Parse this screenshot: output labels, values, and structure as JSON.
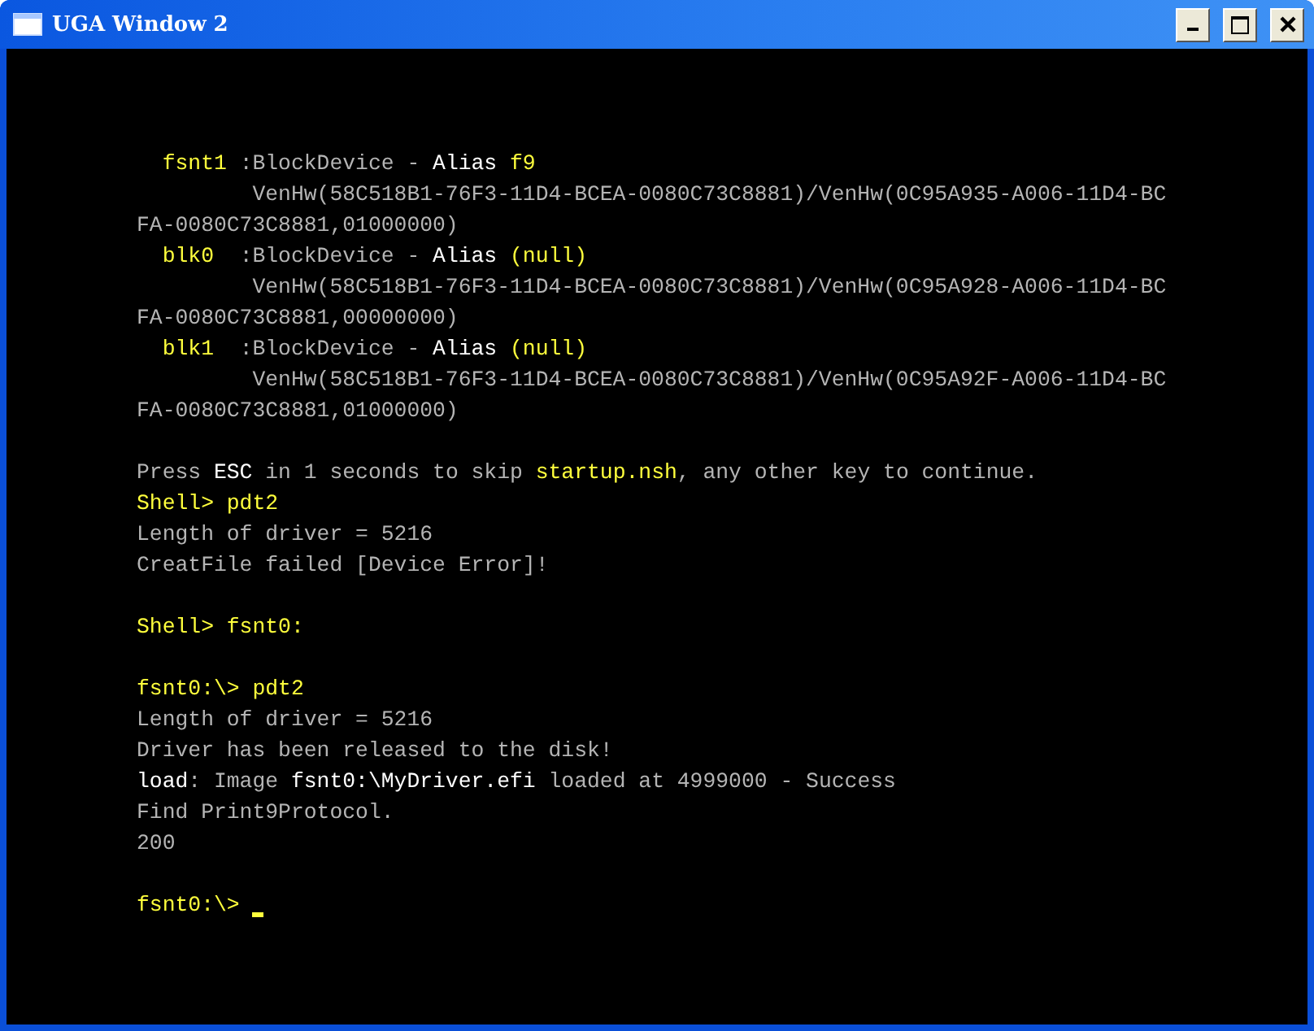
{
  "window": {
    "title": "UGA Window 2"
  },
  "terminal": {
    "lines": [
      {
        "kind": "text",
        "segments": [
          {
            "text": "  fsnt1 ",
            "color": "#ffff3c"
          },
          {
            "text": ":BlockDevice - ",
            "color": "#b4b4b4"
          },
          {
            "text": "Alias ",
            "color": "#ffffff"
          },
          {
            "text": "f9",
            "color": "#ffff3c"
          }
        ]
      },
      {
        "kind": "text",
        "segments": [
          {
            "text": "         VenHw(58C518B1-76F3-11D4-BCEA-0080C73C8881)/VenHw(0C95A935-A006-11D4-BC",
            "color": "#b4b4b4"
          }
        ]
      },
      {
        "kind": "text",
        "segments": [
          {
            "text": "FA-0080C73C8881,01000000)",
            "color": "#b4b4b4"
          }
        ]
      },
      {
        "kind": "text",
        "segments": [
          {
            "text": "  blk0  ",
            "color": "#ffff3c"
          },
          {
            "text": ":BlockDevice - ",
            "color": "#b4b4b4"
          },
          {
            "text": "Alias ",
            "color": "#ffffff"
          },
          {
            "text": "(null)",
            "color": "#ffff3c"
          }
        ]
      },
      {
        "kind": "text",
        "segments": [
          {
            "text": "         VenHw(58C518B1-76F3-11D4-BCEA-0080C73C8881)/VenHw(0C95A928-A006-11D4-BC",
            "color": "#b4b4b4"
          }
        ]
      },
      {
        "kind": "text",
        "segments": [
          {
            "text": "FA-0080C73C8881,00000000)",
            "color": "#b4b4b4"
          }
        ]
      },
      {
        "kind": "text",
        "segments": [
          {
            "text": "  blk1  ",
            "color": "#ffff3c"
          },
          {
            "text": ":BlockDevice - ",
            "color": "#b4b4b4"
          },
          {
            "text": "Alias ",
            "color": "#ffffff"
          },
          {
            "text": "(null)",
            "color": "#ffff3c"
          }
        ]
      },
      {
        "kind": "text",
        "segments": [
          {
            "text": "         VenHw(58C518B1-76F3-11D4-BCEA-0080C73C8881)/VenHw(0C95A92F-A006-11D4-BC",
            "color": "#b4b4b4"
          }
        ]
      },
      {
        "kind": "text",
        "segments": [
          {
            "text": "FA-0080C73C8881,01000000)",
            "color": "#b4b4b4"
          }
        ]
      },
      {
        "kind": "blank"
      },
      {
        "kind": "text",
        "segments": [
          {
            "text": "Press ",
            "color": "#b4b4b4"
          },
          {
            "text": "ESC",
            "color": "#ffffff"
          },
          {
            "text": " in 1 seconds to skip ",
            "color": "#b4b4b4"
          },
          {
            "text": "startup.nsh",
            "color": "#ffff3c"
          },
          {
            "text": ", any other key to continue.",
            "color": "#b4b4b4"
          }
        ]
      },
      {
        "kind": "text",
        "segments": [
          {
            "text": "Shell> pdt2",
            "color": "#ffff3c"
          }
        ]
      },
      {
        "kind": "text",
        "segments": [
          {
            "text": "Length of driver = 5216",
            "color": "#b4b4b4"
          }
        ]
      },
      {
        "kind": "text",
        "segments": [
          {
            "text": "CreatFile failed [Device Error]!",
            "color": "#b4b4b4"
          }
        ]
      },
      {
        "kind": "blank"
      },
      {
        "kind": "text",
        "segments": [
          {
            "text": "Shell> fsnt0:",
            "color": "#ffff3c"
          }
        ]
      },
      {
        "kind": "blank"
      },
      {
        "kind": "text",
        "segments": [
          {
            "text": "fsnt0:\\> pdt2",
            "color": "#ffff3c"
          }
        ]
      },
      {
        "kind": "text",
        "segments": [
          {
            "text": "Length of driver = 5216",
            "color": "#b4b4b4"
          }
        ]
      },
      {
        "kind": "text",
        "segments": [
          {
            "text": "Driver has been released to the disk!",
            "color": "#b4b4b4"
          }
        ]
      },
      {
        "kind": "text",
        "segments": [
          {
            "text": "load",
            "color": "#ffffff"
          },
          {
            "text": ": Image ",
            "color": "#b4b4b4"
          },
          {
            "text": "fsnt0:\\MyDriver.efi",
            "color": "#ffffff"
          },
          {
            "text": " loaded at 4999000 - Success",
            "color": "#b4b4b4"
          }
        ]
      },
      {
        "kind": "text",
        "segments": [
          {
            "text": "Find Print9Protocol.",
            "color": "#b4b4b4"
          }
        ]
      },
      {
        "kind": "text",
        "segments": [
          {
            "text": "200",
            "color": "#b4b4b4"
          }
        ]
      },
      {
        "kind": "blank"
      },
      {
        "kind": "text",
        "cursor": true,
        "segments": [
          {
            "text": "fsnt0:\\> ",
            "color": "#ffff3c"
          }
        ]
      }
    ]
  }
}
